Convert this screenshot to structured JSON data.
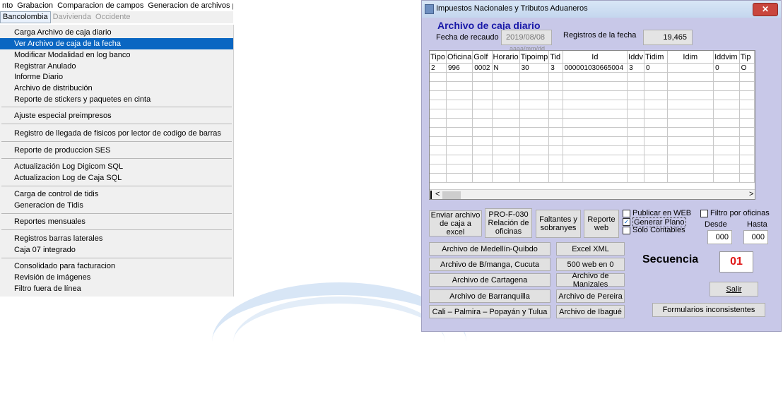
{
  "menubar": {
    "items": [
      "nto",
      "Grabacion",
      "Comparacion de campos",
      "Generacion de archivos pla"
    ]
  },
  "tabs": {
    "items": [
      "Bancolombia",
      "Davivienda",
      "Occidente"
    ]
  },
  "menu": {
    "items": [
      "Carga Archivo de caja diario",
      "Ver Archivo de caja de la fecha",
      "Modificar Modalidad en log banco",
      "Registrar Anulado",
      "Informe Diario",
      "Archivo de distribución",
      "Reporte de stickers y paquetes en cinta",
      "Ajuste especial preimpresos",
      "Registro de llegada de fisicos por lector de codigo de barras",
      "Reporte de produccion SES",
      "Actualización Log Digicom SQL",
      "Actualizacion Log de Caja SQL",
      "Carga de control de tidis",
      "Generacion de Tidis",
      "Reportes mensuales",
      "Registros barras laterales",
      "Caja 07 integrado",
      "Consolidado para facturacion",
      "Revisión de imágenes",
      "Filtro fuera de línea"
    ]
  },
  "window": {
    "title": "Impuestos Nacionales y Tributos Aduaneros",
    "close_glyph": "✕",
    "heading": "Archivo de caja diario",
    "fecha_label": "Fecha de recaudo",
    "fecha_value": "2019/08/08",
    "fecha_hint": "aaaa/mm/dd",
    "registros_label": "Registros de la fecha",
    "registros_value": "19,465"
  },
  "grid": {
    "columns": [
      "Tipo",
      "Oficina",
      "Golf",
      "Horario",
      "Tipoimp",
      "Tid",
      "Id",
      "Iddv",
      "Tidim",
      "Idim",
      "Iddvim",
      "Tip"
    ],
    "row": [
      "2",
      "996",
      "0002",
      "N",
      "30",
      "3",
      "000001030665004",
      "3",
      "0",
      "",
      "0",
      "O"
    ],
    "scroll_up": "^",
    "scroll_down": "v",
    "scroll_left": "<",
    "scroll_right": ">"
  },
  "buttons": {
    "enviar_1": "Enviar archivo",
    "enviar_2": "de caja a excel",
    "pro_1": "PRO-F-030",
    "pro_2": "Relación de",
    "pro_3": "oficinas",
    "faltantes_1": "Faltantes y",
    "faltantes_2": "sobranyes",
    "reporte_1": "Reporte",
    "reporte_2": "web",
    "medellin": "Archivo de Medellín-Quibdo",
    "excel_xml": "Excel XML",
    "bmanga": "Archivo de B/manga, Cucuta",
    "web500": "500 web en 0",
    "cartagena": "Archivo de Cartagena",
    "manizales": "Archivo de Manizales",
    "barranquilla": "Archivo de Barranquilla",
    "pereira": "Archivo de Pereira",
    "cali": "Cali – Palmira – Popayán y Tulua",
    "ibague": "Archivo de Ibagué",
    "salir": "Salir",
    "formularios": "Formularios inconsistentes"
  },
  "options": {
    "publicar": "Publicar en WEB",
    "generar": "Generar Plano",
    "solo": "Solo Contables",
    "filtro": "Filtro por oficinas",
    "desde_label": "Desde",
    "hasta_label": "Hasta",
    "desde_value": "000",
    "hasta_value": "000",
    "check_mark": "✓"
  },
  "secuencia": {
    "label": "Secuencia",
    "value": "01"
  },
  "colors": {
    "selection": "#0a66c2",
    "heading": "#1818a8",
    "secuencia_value": "#e01818",
    "window_bg": "#c8c8e8"
  }
}
